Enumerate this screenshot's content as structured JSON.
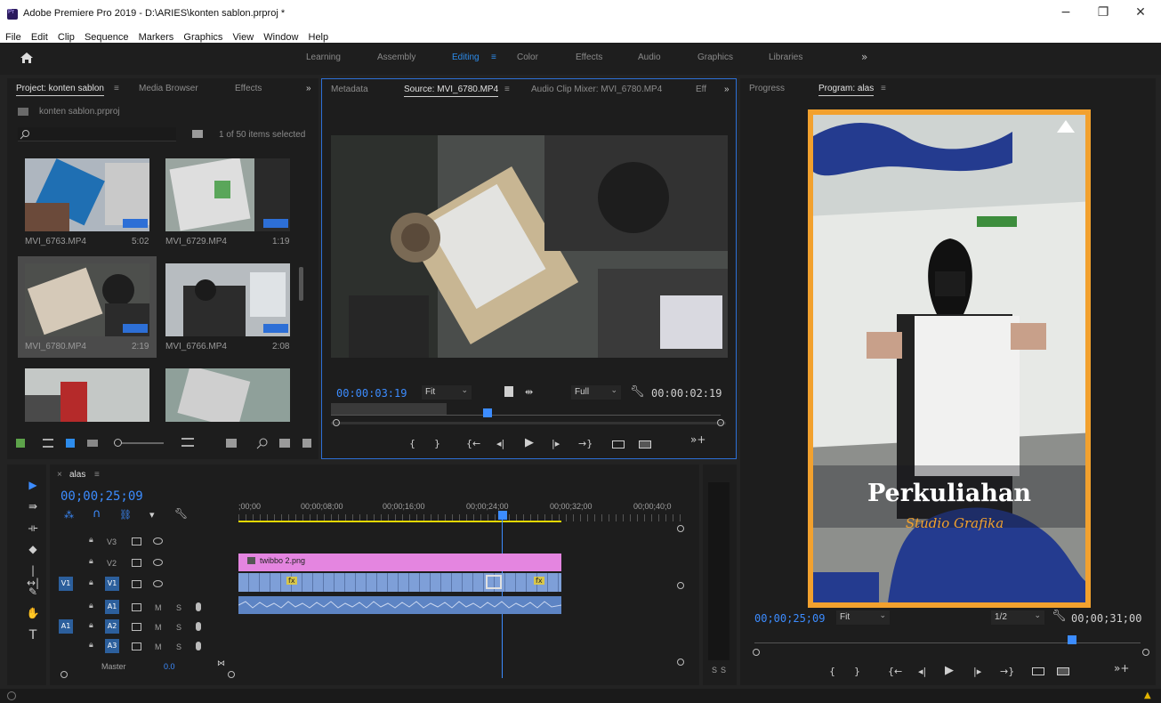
{
  "window": {
    "title": "Adobe Premiere Pro 2019 - D:\\ARIES\\konten sablon.prproj *",
    "minimize": "−",
    "maximize": "❐",
    "close": "✕"
  },
  "menu": [
    "File",
    "Edit",
    "Clip",
    "Sequence",
    "Markers",
    "Graphics",
    "View",
    "Window",
    "Help"
  ],
  "workspaces": [
    "Learning",
    "Assembly",
    "Editing",
    "Color",
    "Effects",
    "Audio",
    "Graphics",
    "Libraries"
  ],
  "workspace_active": "Editing",
  "workspace_menu": "≡",
  "workspace_more": "»",
  "project_panel": {
    "tabs": [
      "Project: konten sablon",
      "Media Browser",
      "Effects"
    ],
    "tab_menu": "≡",
    "more": "»",
    "project_file": "konten sablon.prproj",
    "search_placeholder": "",
    "selection_status": "1 of 50 items selected",
    "items": [
      {
        "name": "MVI_6763.MP4",
        "duration": "5:02"
      },
      {
        "name": "MVI_6729.MP4",
        "duration": "1:19"
      },
      {
        "name": "MVI_6780.MP4",
        "duration": "2:19"
      },
      {
        "name": "MVI_6766.MP4",
        "duration": "2:08"
      },
      {
        "name": "",
        "duration": ""
      },
      {
        "name": "",
        "duration": ""
      }
    ]
  },
  "source_panel": {
    "tabs": [
      "Metadata",
      "Source: MVI_6780.MP4",
      "Audio Clip Mixer: MVI_6780.MP4",
      "Eff"
    ],
    "tab_menu": "≡",
    "more": "»",
    "timecode": "00:00:03:19",
    "zoom": "Fit",
    "resolution": "Full",
    "duration": "00:00:02:19",
    "playhead_fraction": 0.39
  },
  "program_panel": {
    "tabs": [
      "Progress",
      "Program: alas"
    ],
    "tab_menu": "≡",
    "timecode": "00;00;25;09",
    "zoom": "Fit",
    "resolution": "1/2",
    "duration": "00;00;31;00",
    "frame_text": {
      "title": "Perkuliahan",
      "subtitle": "Studio Grafika"
    }
  },
  "timeline": {
    "sequence_name": "alas",
    "close": "×",
    "menu": "≡",
    "timecode": "00;00;25;09",
    "ruler": [
      ";00;00",
      "00;00;08;00",
      "00;00;16;00",
      "00;00;24;00",
      "00;00;32;00",
      "00;00;40;0"
    ],
    "tracks": [
      {
        "id": "V3",
        "kind": "video"
      },
      {
        "id": "V2",
        "kind": "video"
      },
      {
        "id": "V1",
        "kind": "video",
        "source": "V1"
      },
      {
        "id": "A1",
        "kind": "audio",
        "labels": [
          "M",
          "S"
        ]
      },
      {
        "id": "A2",
        "kind": "audio",
        "source": "A1",
        "labels": [
          "M",
          "S"
        ]
      },
      {
        "id": "A3",
        "kind": "audio",
        "labels": [
          "M",
          "S"
        ]
      }
    ],
    "master_label": "Master",
    "master_value": "0.0",
    "clip_v2": "twibbo 2.png",
    "fx_label": "fx",
    "vu_labels": [
      "S",
      "S"
    ]
  },
  "colors": {
    "accent_blue": "#2d8ceb",
    "timecode_blue": "#3c8cff",
    "clip_pink": "#e485e0",
    "clip_blue": "#7e9fd8",
    "audio_clip": "#5d84c4",
    "ruler_yellow": "#e3d800",
    "frame_orange": "#f2a12e"
  }
}
